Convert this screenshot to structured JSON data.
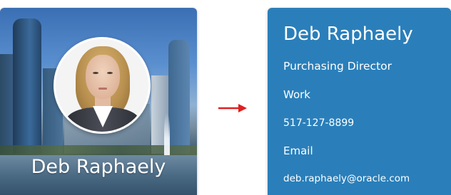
{
  "front_card": {
    "name": "Deb Raphaely"
  },
  "back_card": {
    "name": "Deb Raphaely",
    "title": "Purchasing Director",
    "work_label": "Work",
    "phone": "517-127-8899",
    "email_label": "Email",
    "email": "deb.raphaely@oracle.com"
  },
  "colors": {
    "card_blue": "#2a7fba",
    "arrow_red": "#e02020"
  },
  "icons": {
    "arrow": "arrow-right-icon"
  }
}
